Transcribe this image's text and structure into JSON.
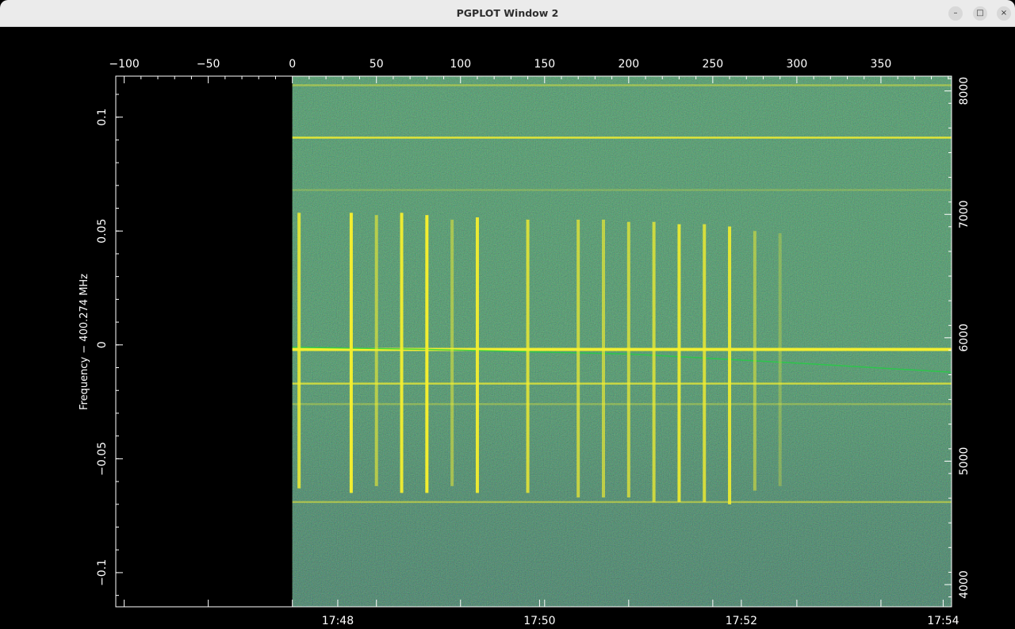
{
  "window": {
    "title": "PGPLOT Window 2",
    "controls": {
      "minimize": "–",
      "maximize": "□",
      "close": "×"
    }
  },
  "chart_data": {
    "type": "heatmap",
    "colors": {
      "background": "#000000",
      "spectrum_base": "#2c9a7b",
      "signal": "#f2ee30",
      "trace": "#20d040"
    },
    "ylabel": "Frequency − 400.274 MHz",
    "xlim_top": [
      -105,
      392
    ],
    "ylim": [
      -0.115,
      0.118
    ],
    "data_x_range": [
      0,
      392
    ],
    "top_axis_ticks": [
      "−100",
      "−50",
      "0",
      "50",
      "100",
      "150",
      "200",
      "250",
      "300",
      "350"
    ],
    "top_axis_values": [
      -100,
      -50,
      0,
      50,
      100,
      150,
      200,
      250,
      300,
      350
    ],
    "left_axis_ticks": [
      "0.1",
      "0.05",
      "0",
      "−0.05",
      "−0.1"
    ],
    "left_axis_values": [
      0.1,
      0.05,
      0,
      -0.05,
      -0.1
    ],
    "right_axis_ticks": [
      "8000",
      "7000",
      "6000",
      "5000",
      "4000"
    ],
    "right_axis_values": [
      8000,
      7000,
      6000,
      5000,
      4000
    ],
    "right_axis_range": [
      3820,
      8120
    ],
    "bottom_axis_ticks": [
      "17:48",
      "17:50",
      "17:52",
      "17:54"
    ],
    "bottom_axis_values": [
      27,
      147,
      267,
      387
    ],
    "carrier_frequency": -0.002,
    "horizontal_lines": [
      {
        "y": 0.091,
        "strength": 0.9
      },
      {
        "y": 0.068,
        "strength": 0.25
      },
      {
        "y": -0.002,
        "strength": 1.0
      },
      {
        "y": -0.017,
        "strength": 0.75
      },
      {
        "y": -0.026,
        "strength": 0.35
      },
      {
        "y": -0.069,
        "strength": 0.5
      },
      {
        "y": 0.114,
        "strength": 0.45
      }
    ],
    "pulses": [
      {
        "x": 4,
        "y_top": 0.058,
        "y_bottom": -0.063,
        "strength": 0.85
      },
      {
        "x": 35,
        "y_top": 0.058,
        "y_bottom": -0.065,
        "strength": 1.0
      },
      {
        "x": 50,
        "y_top": 0.057,
        "y_bottom": -0.062,
        "strength": 0.6
      },
      {
        "x": 65,
        "y_top": 0.058,
        "y_bottom": -0.065,
        "strength": 0.95
      },
      {
        "x": 80,
        "y_top": 0.057,
        "y_bottom": -0.065,
        "strength": 1.0
      },
      {
        "x": 95,
        "y_top": 0.055,
        "y_bottom": -0.062,
        "strength": 0.5
      },
      {
        "x": 110,
        "y_top": 0.056,
        "y_bottom": -0.065,
        "strength": 0.95
      },
      {
        "x": 140,
        "y_top": 0.055,
        "y_bottom": -0.065,
        "strength": 0.8
      },
      {
        "x": 170,
        "y_top": 0.055,
        "y_bottom": -0.067,
        "strength": 0.7
      },
      {
        "x": 185,
        "y_top": 0.055,
        "y_bottom": -0.067,
        "strength": 0.65
      },
      {
        "x": 200,
        "y_top": 0.054,
        "y_bottom": -0.067,
        "strength": 0.7
      },
      {
        "x": 215,
        "y_top": 0.054,
        "y_bottom": -0.069,
        "strength": 0.75
      },
      {
        "x": 230,
        "y_top": 0.053,
        "y_bottom": -0.069,
        "strength": 0.9
      },
      {
        "x": 245,
        "y_top": 0.053,
        "y_bottom": -0.069,
        "strength": 0.8
      },
      {
        "x": 260,
        "y_top": 0.052,
        "y_bottom": -0.07,
        "strength": 0.9
      },
      {
        "x": 275,
        "y_top": 0.05,
        "y_bottom": -0.064,
        "strength": 0.5
      },
      {
        "x": 290,
        "y_top": 0.049,
        "y_bottom": -0.062,
        "strength": 0.3
      }
    ],
    "drift_trace": [
      {
        "x": 0,
        "y": -0.001
      },
      {
        "x": 80,
        "y": -0.002
      },
      {
        "x": 200,
        "y": -0.004
      },
      {
        "x": 300,
        "y": -0.008
      },
      {
        "x": 392,
        "y": -0.012
      }
    ]
  }
}
